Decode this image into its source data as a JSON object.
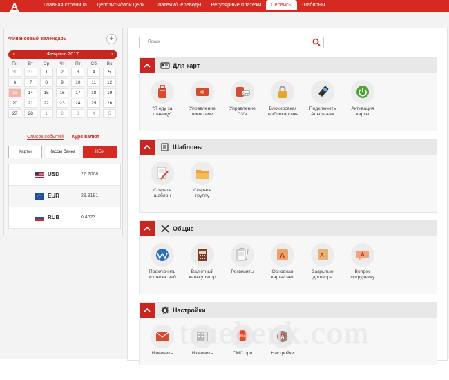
{
  "nav": {
    "items": [
      "Главная страница",
      "Депозиты/Мои цели",
      "Платежи/Переводы",
      "Регулярные платежи",
      "Сервисы",
      "Шаблоны"
    ],
    "active": "Сервисы",
    "logo": "А"
  },
  "calendar": {
    "title": "Финансовый календарь",
    "plus": "+",
    "month": "Февраль 2017",
    "prev": "‹",
    "next": "›",
    "weekdays": [
      "Пн",
      "Вт",
      "Ср",
      "Чт",
      "Пт",
      "Сб",
      "Вс"
    ],
    "weeks": [
      [
        "30",
        "31",
        "1",
        "2",
        "3",
        "4",
        "5"
      ],
      [
        "6",
        "7",
        "8",
        "9",
        "10",
        "11",
        "12"
      ],
      [
        "13",
        "14",
        "15",
        "16",
        "17",
        "18",
        "19"
      ],
      [
        "20",
        "21",
        "22",
        "23",
        "24",
        "25",
        "26"
      ],
      [
        "27",
        "28",
        "1",
        "2",
        "3",
        "4",
        "5"
      ]
    ],
    "today": "13",
    "events_link": "Список событий",
    "rates_link": "Курс валют",
    "buttons": [
      "Карты",
      "Кассы банка",
      "НБУ"
    ]
  },
  "rates": [
    {
      "code": "USD",
      "value": "27.2068"
    },
    {
      "code": "EUR",
      "value": "28.9181"
    },
    {
      "code": "RUB",
      "value": "0.4623"
    }
  ],
  "search": {
    "placeholder": "Поиск"
  },
  "sections": [
    {
      "title": "Для карт",
      "items": [
        "\"Я еду за\nграницу\"",
        "Управление\nлимитами",
        "Управление\nCVV",
        "Блокировка/\nразблокировка",
        "Подключить\nАльфа-чек",
        "Активация\nкарты"
      ]
    },
    {
      "title": "Шаблоны",
      "items": [
        "Создать\nшаблон",
        "Создать\nгруппу"
      ]
    },
    {
      "title": "Общие",
      "items": [
        "Подключить\nкошелек веб",
        "Валютный\nкалькулятор",
        "Реквизиты",
        "Основная\nкарта/счет",
        "Закрытые\nдоговора",
        "Вопрос\nсотруднику"
      ]
    },
    {
      "title": "Настройки",
      "items": [
        "Изменить",
        "Изменить",
        "СМС при",
        "Настройки"
      ]
    }
  ],
  "watermark": "truehenk.com",
  "colors": {
    "brand": "#d42a22"
  }
}
